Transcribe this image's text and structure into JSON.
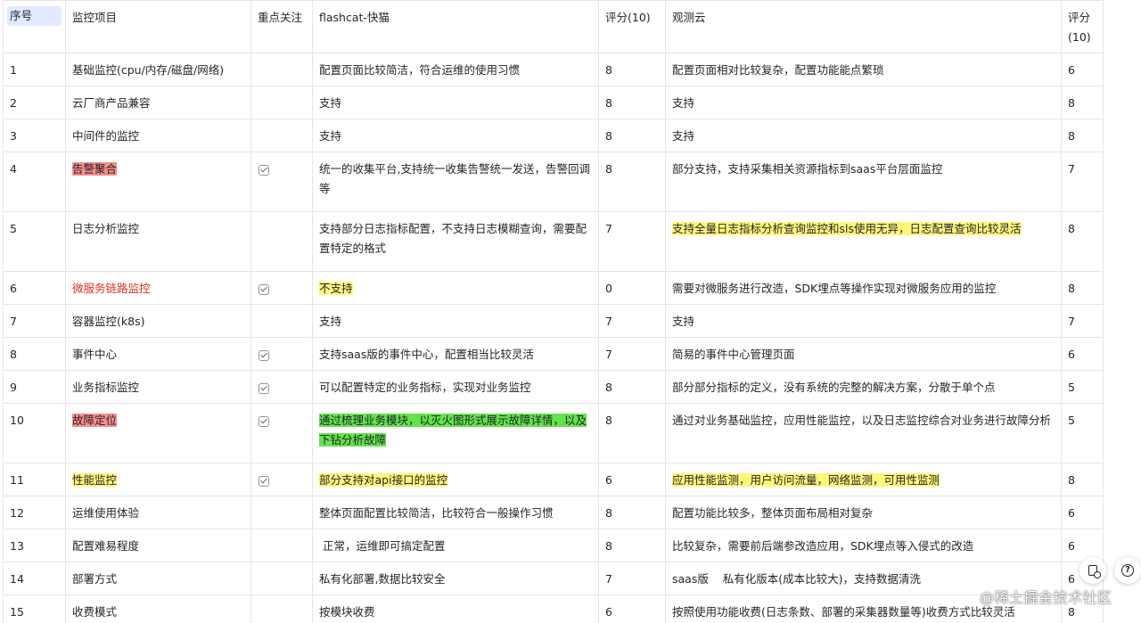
{
  "table": {
    "headers": {
      "seq": "序号",
      "item": "监控项目",
      "focus": "重点关注",
      "flashcat": "flashcat-快猫",
      "score1": "评分(10)",
      "guance": "观测云",
      "score2": "评分(10)"
    },
    "rows": [
      {
        "seq": "1",
        "item": "基础监控(cpu/内存/磁盘/网络)",
        "flashcat": "配置页面比较简洁，符合运维的使用习惯",
        "score1": "8",
        "guance": "配置页面相对比较复杂，配置功能能点繁琐",
        "score2": "6"
      },
      {
        "seq": "2",
        "item": "云厂商产品兼容",
        "flashcat": "支持",
        "score1": "8",
        "guance": "支持",
        "score2": "8"
      },
      {
        "seq": "3",
        "item": "中间件的监控",
        "flashcat": "支持",
        "score1": "8",
        "guance": "支持",
        "score2": "8"
      },
      {
        "seq": "4",
        "item": "告警聚合",
        "flashcat": "统一的收集平台,支持统一收集告警统一发送，告警回调等",
        "score1": "8",
        "guance": "部分支持，支持采集相关资源指标到saas平台层面监控",
        "score2": "7"
      },
      {
        "seq": "5",
        "item": "日志分析监控",
        "flashcat": "支持部分日志指标配置，不支持日志模糊查询，需要配置特定的格式",
        "score1": "7",
        "guance": "支持全量日志指标分析查询监控和sls使用无异，日志配置查询比较灵活",
        "score2": "8"
      },
      {
        "seq": "6",
        "item": "微服务链路监控",
        "flashcat": "不支持",
        "score1": "0",
        "guance": "需要对微服务进行改造，SDK埋点等操作实现对微服务应用的监控",
        "score2": "8"
      },
      {
        "seq": "7",
        "item": "容器监控(k8s)",
        "flashcat": "支持",
        "score1": "7",
        "guance": "支持",
        "score2": "7"
      },
      {
        "seq": "8",
        "item": "事件中心",
        "flashcat": "支持saas版的事件中心，配置相当比较灵活",
        "score1": "7",
        "guance": "简易的事件中心管理页面",
        "score2": "6"
      },
      {
        "seq": "9",
        "item": "业务指标监控",
        "flashcat": "可以配置特定的业务指标，实现对业务监控",
        "score1": "8",
        "guance": "部分部分指标的定义，没有系统的完整的解决方案，分散于单个点",
        "score2": "5"
      },
      {
        "seq": "10",
        "item": "故障定位",
        "flashcat": "通过梳理业务模块，以灭火图形式展示故障详情，以及下钻分析故障",
        "score1": "8",
        "guance": "通过对业务基础监控，应用性能监控，以及日志监控综合对业务进行故障分析",
        "score2": "5"
      },
      {
        "seq": "11",
        "item": "性能监控",
        "flashcat": "部分支持对api接口的监控",
        "score1": "6",
        "guance": "应用性能监测，用户访问流量，网络监测，可用性监测",
        "score2": "8"
      },
      {
        "seq": "12",
        "item": "运维使用体验",
        "flashcat": "整体页面配置比较简洁，比较符合一般操作习惯",
        "score1": "8",
        "guance": "配置功能比较多，整体页面布局相对复杂",
        "score2": "6"
      },
      {
        "seq": "13",
        "item": "配置难易程度",
        "flashcat": " 正常，运维即可搞定配置",
        "score1": "8",
        "guance": "比较复杂，需要前后端参改造应用，SDK埋点等入侵式的改造",
        "score2": "6"
      },
      {
        "seq": "14",
        "item": "部署方式",
        "flashcat": "私有化部署,数据比较安全",
        "score1": "7",
        "guance": "saas版    私有化版本(成本比较大)，支持数据清洗",
        "score2": "6"
      },
      {
        "seq": "15",
        "item": "收费模式",
        "flashcat": "按模块收费",
        "score1": "6",
        "guance": "按照使用功能收费(日志条数、部署的采集器数量等)收费方式比较灵活",
        "score2": "8"
      }
    ]
  },
  "watermark": "@稀土掘金技术社区",
  "colors": {
    "highlight_red": "#f98e8b",
    "highlight_yellow": "#fff67a",
    "highlight_green": "#64e34d",
    "text_red": "#e22e28",
    "header_chip": "#e1eaff",
    "border": "#e4e6eb"
  },
  "icons": {
    "focus_checked": "checkbox-checked-icon",
    "fab_left": "document-comment-icon",
    "fab_right": "help-icon"
  }
}
